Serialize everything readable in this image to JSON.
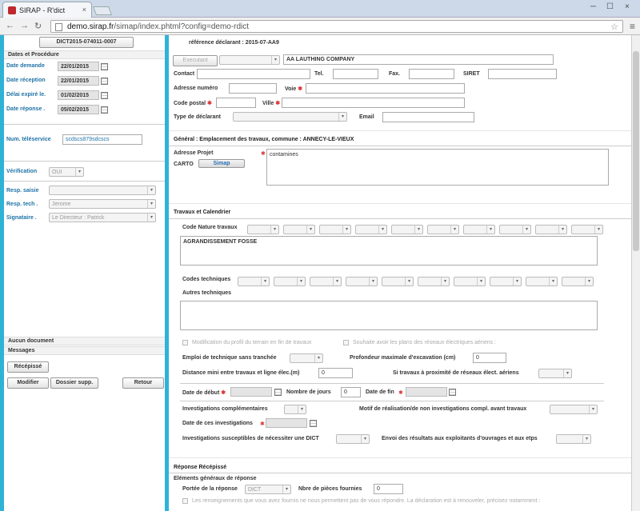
{
  "browser": {
    "tab_title": "SIRAP - R'dict",
    "url_host": "demo.sirap.fr",
    "url_path": "/simap/index.phtml?config=demo-rdict",
    "close_glyph": "×"
  },
  "left": {
    "dict_id": "DICT2015-074011-0007",
    "section_dates": "Dates et Procédure",
    "date_demande_label": "Date demande",
    "date_demande": "22/01/2015",
    "date_reception_label": "Date réception",
    "date_reception": "22/01/2015",
    "delai_label": "Délai expiré le.",
    "delai": "01/02/2015",
    "date_reponse_label": "Date réponse .",
    "date_reponse": "05/02/2015",
    "teleservice_label": "Num. téléservice",
    "teleservice": "scdscs879sdcscs",
    "verification_label": "Vérification",
    "verification": "OUI",
    "resp_saisie_label": "Resp. saisie",
    "resp_tech_label": "Resp. tech .",
    "resp_tech": "Jerome",
    "signataire_label": "Signataire .",
    "signataire": "Le Directeur : Patrick",
    "aucun_doc": "Aucun document",
    "messages": "Messages",
    "recepisse_btn": "Récépissé",
    "modifier_btn": "Modifier",
    "dossier_btn": "Dossier supp.",
    "retour_btn": "Retour"
  },
  "declarant": {
    "ref_label": "référence déclarant : 2015-07-AA9",
    "executant_btn": "Executant",
    "company": "AA LAUTHING COMPANY",
    "contact_label": "Contact",
    "tel_label": "Tel.",
    "fax_label": "Fax.",
    "siret_label": "SIRET",
    "adresse_num_label": "Adresse numéro",
    "voie_label": "Voie",
    "code_postal_label": "Code postal",
    "ville_label": "Ville",
    "type_label": "Type de déclarant",
    "email_label": "Email"
  },
  "general": {
    "title": "Général : Emplacement des travaux, commune : ANNECY-LE-VIEUX",
    "adresse_label": "Adresse Projet",
    "carto_label": "CARTO",
    "simap": "Simap",
    "adresse_value": "contamines"
  },
  "travaux": {
    "title": "Travaux et Calendrier",
    "code_nature_label": "Code Nature travaux",
    "nature_text": "AGRANDISSEMENT FOSSE",
    "codes_tech_label": "Codes techniques",
    "autres_tech_label": "Autres techniques",
    "modif_profil": "Modification du profil du terrain en fin de travaux",
    "souhaite_plans": "Souhaite avoir les plans des réseaux électriques aériens :",
    "emploi_label": "Emploi de technique sans tranchée",
    "profondeur_label": "Profondeur maximale d'excavation (cm)",
    "profondeur": "0",
    "distance_label": "Distance mini entre travaux et ligne élec.(m)",
    "distance": "0",
    "si_travaux_label": "Si travaux à proximité de réseaux élect. aériens",
    "date_debut_label": "Date de début",
    "nb_jours_label": "Nombre de jours",
    "nb_jours": "0",
    "date_fin_label": "Date de fin",
    "invest_label": "Investigations complémentaires",
    "motif_label": "Motif de réalisation/de non investigations compl. avant travaux",
    "date_invest_label": "Date de ces investigations",
    "invest_dict_label": "Investigations susceptibles de nécessiter une DICT",
    "envoi_label": "Envoi des résultats aux exploitants d'ouvrages et aux etps"
  },
  "reponse": {
    "title": "Réponse Récépissé",
    "elements": "Eléments généraux de réponse",
    "portee_label": "Portée de la réponse",
    "portee": "DICT",
    "nb_pieces_label": "Nbre de pièces fournies",
    "nb_pieces": "0",
    "note": "Les renseignements que vous avez fournis ne nous permettent pas de vous répondre. La déclaration est à renouveler, précisez notamment :"
  }
}
